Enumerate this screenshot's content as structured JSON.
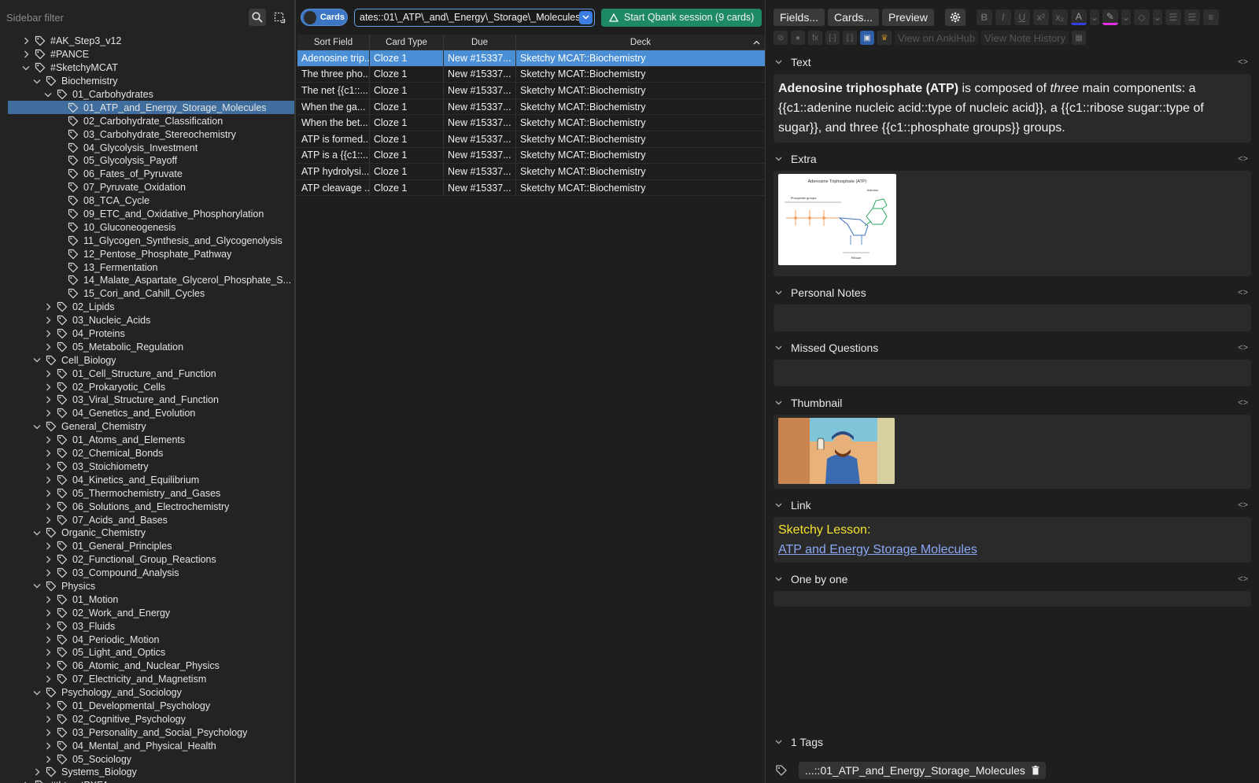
{
  "sidebar": {
    "filter_placeholder": "Sidebar filter",
    "tree": [
      {
        "label": "#AK_Step3_v12",
        "depth": 0,
        "chev": "right"
      },
      {
        "label": "#PANCE",
        "depth": 0,
        "chev": "right"
      },
      {
        "label": "#SketchyMCAT",
        "depth": 0,
        "chev": "down"
      },
      {
        "label": "Biochemistry",
        "depth": 1,
        "chev": "down"
      },
      {
        "label": "01_Carbohydrates",
        "depth": 2,
        "chev": "down"
      },
      {
        "label": "01_ATP_and_Energy_Storage_Molecules",
        "depth": 3,
        "chev": "none",
        "selected": true
      },
      {
        "label": "02_Carbohydrate_Classification",
        "depth": 3,
        "chev": "none"
      },
      {
        "label": "03_Carbohydrate_Stereochemistry",
        "depth": 3,
        "chev": "none"
      },
      {
        "label": "04_Glycolysis_Investment",
        "depth": 3,
        "chev": "none"
      },
      {
        "label": "05_Glycolysis_Payoff",
        "depth": 3,
        "chev": "none"
      },
      {
        "label": "06_Fates_of_Pyruvate",
        "depth": 3,
        "chev": "none"
      },
      {
        "label": "07_Pyruvate_Oxidation",
        "depth": 3,
        "chev": "none"
      },
      {
        "label": "08_TCA_Cycle",
        "depth": 3,
        "chev": "none"
      },
      {
        "label": "09_ETC_and_Oxidative_Phosphorylation",
        "depth": 3,
        "chev": "none"
      },
      {
        "label": "10_Gluconeogenesis",
        "depth": 3,
        "chev": "none"
      },
      {
        "label": "11_Glycogen_Synthesis_and_Glycogenolysis",
        "depth": 3,
        "chev": "none"
      },
      {
        "label": "12_Pentose_Phosphate_Pathway",
        "depth": 3,
        "chev": "none"
      },
      {
        "label": "13_Fermentation",
        "depth": 3,
        "chev": "none"
      },
      {
        "label": "14_Malate_Aspartate_Glycerol_Phosphate_S...",
        "depth": 3,
        "chev": "none"
      },
      {
        "label": "15_Cori_and_Cahill_Cycles",
        "depth": 3,
        "chev": "none"
      },
      {
        "label": "02_Lipids",
        "depth": 2,
        "chev": "right"
      },
      {
        "label": "03_Nucleic_Acids",
        "depth": 2,
        "chev": "right"
      },
      {
        "label": "04_Proteins",
        "depth": 2,
        "chev": "right"
      },
      {
        "label": "05_Metabolic_Regulation",
        "depth": 2,
        "chev": "right"
      },
      {
        "label": "Cell_Biology",
        "depth": 1,
        "chev": "down"
      },
      {
        "label": "01_Cell_Structure_and_Function",
        "depth": 2,
        "chev": "right"
      },
      {
        "label": "02_Prokaryotic_Cells",
        "depth": 2,
        "chev": "right"
      },
      {
        "label": "03_Viral_Structure_and_Function",
        "depth": 2,
        "chev": "right"
      },
      {
        "label": "04_Genetics_and_Evolution",
        "depth": 2,
        "chev": "right"
      },
      {
        "label": "General_Chemistry",
        "depth": 1,
        "chev": "down"
      },
      {
        "label": "01_Atoms_and_Elements",
        "depth": 2,
        "chev": "right"
      },
      {
        "label": "02_Chemical_Bonds",
        "depth": 2,
        "chev": "right"
      },
      {
        "label": "03_Stoichiometry",
        "depth": 2,
        "chev": "right"
      },
      {
        "label": "04_Kinetics_and_Equilibrium",
        "depth": 2,
        "chev": "right"
      },
      {
        "label": "05_Thermochemistry_and_Gases",
        "depth": 2,
        "chev": "right"
      },
      {
        "label": "06_Solutions_and_Electrochemistry",
        "depth": 2,
        "chev": "right"
      },
      {
        "label": "07_Acids_and_Bases",
        "depth": 2,
        "chev": "right"
      },
      {
        "label": "Organic_Chemistry",
        "depth": 1,
        "chev": "down"
      },
      {
        "label": "01_General_Principles",
        "depth": 2,
        "chev": "right"
      },
      {
        "label": "02_Functional_Group_Reactions",
        "depth": 2,
        "chev": "right"
      },
      {
        "label": "03_Compound_Analysis",
        "depth": 2,
        "chev": "right"
      },
      {
        "label": "Physics",
        "depth": 1,
        "chev": "down"
      },
      {
        "label": "01_Motion",
        "depth": 2,
        "chev": "right"
      },
      {
        "label": "02_Work_and_Energy",
        "depth": 2,
        "chev": "right"
      },
      {
        "label": "03_Fluids",
        "depth": 2,
        "chev": "right"
      },
      {
        "label": "04_Periodic_Motion",
        "depth": 2,
        "chev": "right"
      },
      {
        "label": "05_Light_and_Optics",
        "depth": 2,
        "chev": "right"
      },
      {
        "label": "06_Atomic_and_Nuclear_Physics",
        "depth": 2,
        "chev": "right"
      },
      {
        "label": "07_Electricity_and_Magnetism",
        "depth": 2,
        "chev": "right"
      },
      {
        "label": "Psychology_and_Sociology",
        "depth": 1,
        "chev": "down"
      },
      {
        "label": "01_Developmental_Psychology",
        "depth": 2,
        "chev": "right"
      },
      {
        "label": "02_Cognitive_Psychology",
        "depth": 2,
        "chev": "right"
      },
      {
        "label": "03_Personality_and_Social_Psychology",
        "depth": 2,
        "chev": "right"
      },
      {
        "label": "04_Mental_and_Physical_Health",
        "depth": 2,
        "chev": "right"
      },
      {
        "label": "05_Sociology",
        "depth": 2,
        "chev": "right"
      },
      {
        "label": "Systems_Biology",
        "depth": 1,
        "chev": "right"
      },
      {
        "label": "#thtrentPXFA",
        "depth": 0,
        "chev": "right"
      }
    ]
  },
  "browser": {
    "toggle_label": "Cards",
    "search_value": "ates::01\\_ATP\\_and\\_Energy\\_Storage\\_Molecules",
    "qbank_label": "Start Qbank session (9 cards)",
    "columns": [
      "Sort Field",
      "Card Type",
      "Due",
      "Deck"
    ],
    "rows": [
      {
        "sort": "Adenosine trip...",
        "type": "Cloze 1",
        "due": "New #15337...",
        "deck": "Sketchy MCAT::Biochemistry",
        "selected": true
      },
      {
        "sort": "The three pho...",
        "type": "Cloze 1",
        "due": "New #15337...",
        "deck": "Sketchy MCAT::Biochemistry"
      },
      {
        "sort": "The net {{c1::...",
        "type": "Cloze 1",
        "due": "New #15337...",
        "deck": "Sketchy MCAT::Biochemistry"
      },
      {
        "sort": "When the ga...",
        "type": "Cloze 1",
        "due": "New #15337...",
        "deck": "Sketchy MCAT::Biochemistry"
      },
      {
        "sort": "When the bet...",
        "type": "Cloze 1",
        "due": "New #15337...",
        "deck": "Sketchy MCAT::Biochemistry"
      },
      {
        "sort": "ATP is formed...",
        "type": "Cloze 1",
        "due": "New #15337...",
        "deck": "Sketchy MCAT::Biochemistry"
      },
      {
        "sort": "ATP is a {{c1::...",
        "type": "Cloze 1",
        "due": "New #15337...",
        "deck": "Sketchy MCAT::Biochemistry"
      },
      {
        "sort": "ATP hydrolysi...",
        "type": "Cloze 1",
        "due": "New #15337...",
        "deck": "Sketchy MCAT::Biochemistry"
      },
      {
        "sort": "ATP cleavage ...",
        "type": "Cloze 1",
        "due": "New #15337...",
        "deck": "Sketchy MCAT::Biochemistry"
      }
    ]
  },
  "editor": {
    "toolbar": {
      "fields": "Fields...",
      "cards": "Cards...",
      "preview": "Preview"
    },
    "toolbar2": {
      "ankihub": "View on AnkiHub",
      "history": "View Note History"
    },
    "fields": {
      "text_label": "Text",
      "text_bold": "Adenosine triphosphate (ATP)",
      "text_part1": " is composed of ",
      "text_italic": "three",
      "text_part2": " main components: a {{c1::adenine nucleic acid::type of nucleic acid}}, a {{c1::ribose sugar::type of sugar}}, and three {{c1::phosphate groups}} groups.",
      "extra_label": "Extra",
      "extra_img_title": "Adenosine Triphosphate (ATP)",
      "extra_img_phos": "Phosphate groups",
      "extra_img_adenine": "Adenine",
      "extra_img_ribose": "Ribose",
      "personal_label": "Personal Notes",
      "missed_label": "Missed Questions",
      "thumb_label": "Thumbnail",
      "link_label": "Link",
      "link_prefix": "Sketchy Lesson:",
      "link_text": "ATP and Energy Storage Molecules",
      "one_label": "One by one",
      "code_glyph": "<>"
    },
    "tags": {
      "header": "1 Tags",
      "tag": "...::01_ATP_and_Energy_Storage_Molecules"
    }
  },
  "colors": {
    "accent": "#3a76c4",
    "selection": "#4a8fd6",
    "qbank": "#1d8a63",
    "link_yellow": "#f5e32a",
    "link_blue": "#8ba8f5"
  }
}
